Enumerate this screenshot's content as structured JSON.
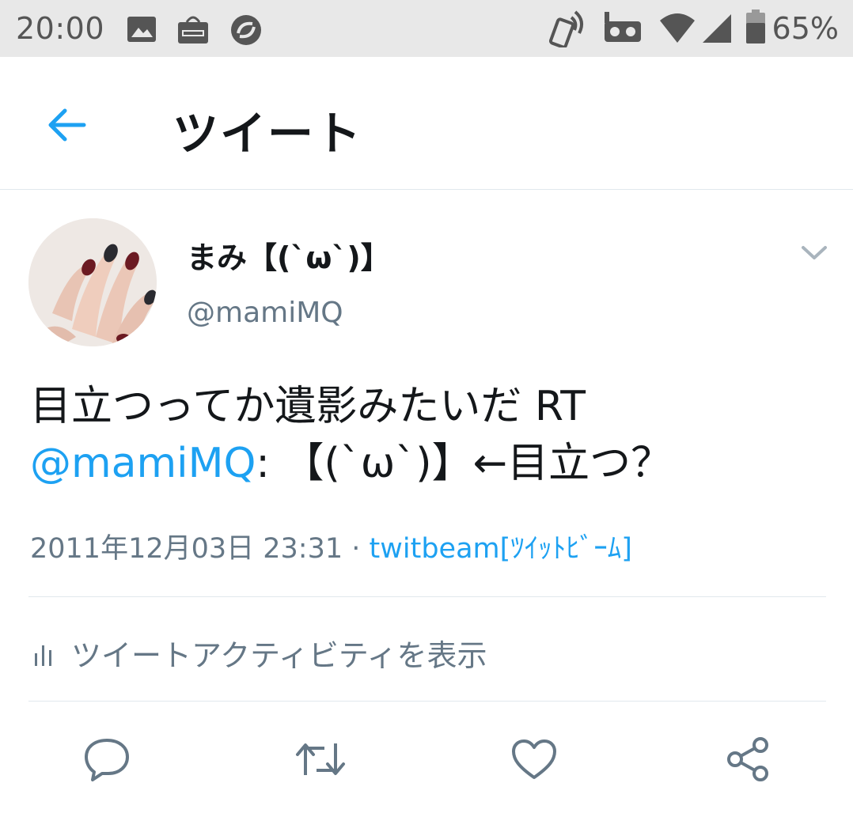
{
  "status_bar": {
    "time": "20:00",
    "battery_percent": "65%",
    "left_icons": [
      "image-icon",
      "market-icon",
      "sync-app-icon"
    ],
    "right_icons": [
      "nfc-phone-icon",
      "vr-icon",
      "wifi-icon",
      "signal-icon",
      "battery-icon"
    ]
  },
  "app_bar": {
    "back_icon": "back-arrow-icon",
    "title": "ツイート"
  },
  "tweet": {
    "display_name": "まみ【(`ω`)】",
    "handle": "@mamiMQ",
    "text_part1": "目立つってか遺影みたいだ RT ",
    "mention": "@mamiMQ",
    "text_part2": ": 【(`ω`)】←目立つ？",
    "timestamp": "2011年12月03日 23:31",
    "separator": " · ",
    "source": "twitbeam[ﾂｲｯﾄﾋﾞｰﾑ]"
  },
  "activity": {
    "label": "ツイートアクティビティを表示"
  },
  "actions": [
    "reply-icon",
    "retweet-icon",
    "like-icon",
    "share-icon"
  ],
  "colors": {
    "accent": "#1da1f2",
    "secondary_text": "#657786",
    "primary_text": "#14171a",
    "divider": "#e1e8ed",
    "status_bar_bg": "#e8e8e8"
  }
}
